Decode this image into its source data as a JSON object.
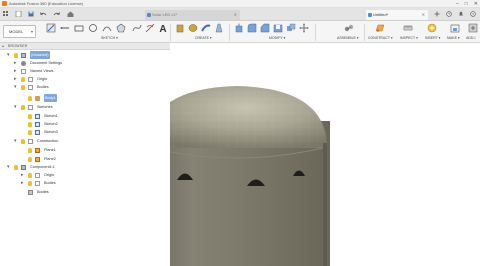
{
  "window": {
    "app_title": "Autodesk Fusion 360 (Education License)",
    "controls": [
      "–",
      "□",
      "✕"
    ]
  },
  "tabs": [
    {
      "label": "Solar LED v1*",
      "active": false
    },
    {
      "label": "Untitled*",
      "active": true
    }
  ],
  "workspace": {
    "label": "MODEL"
  },
  "ribbon_groups": [
    {
      "label": "SKETCH ▾"
    },
    {
      "label": "CREATE ▾"
    },
    {
      "label": "MODIFY ▾"
    },
    {
      "label": "ASSEMBLE ▾"
    },
    {
      "label": "CONSTRUCT ▾"
    },
    {
      "label": "INSPECT ▾"
    },
    {
      "label": "INSERT ▾"
    },
    {
      "label": "MAKE ▾"
    },
    {
      "label": "ADD-I"
    }
  ],
  "browser": {
    "header": "BROWSER",
    "items": [
      {
        "label": "(Unsaved)",
        "icon": "component-icon",
        "highlight": true
      },
      {
        "label": "Document Settings",
        "icon": "gear-icon"
      },
      {
        "label": "Named Views",
        "icon": "folder-icon"
      },
      {
        "label": "Origin",
        "icon": "folder-icon"
      },
      {
        "label": "Bodies",
        "icon": "folder-icon"
      },
      {
        "label": "Body1",
        "icon": "body-icon"
      },
      {
        "label": "Sketches",
        "icon": "folder-icon"
      },
      {
        "label": "Sketch1",
        "icon": "sketch-icon"
      },
      {
        "label": "Sketch2",
        "icon": "sketch-icon"
      },
      {
        "label": "Sketch3",
        "icon": "sketch-icon"
      },
      {
        "label": "Construction",
        "icon": "folder-icon"
      },
      {
        "label": "Plane1",
        "icon": "plane-icon"
      },
      {
        "label": "Plane2",
        "icon": "plane-icon"
      },
      {
        "label": "Component1:1",
        "icon": "component-icon"
      },
      {
        "label": "Origin",
        "icon": "folder-icon"
      },
      {
        "label": "Bodies",
        "icon": "folder-icon"
      },
      {
        "label": "Bodies",
        "icon": "body-icon"
      }
    ]
  },
  "colors": {
    "accent": "#f07c1a",
    "bulb": "#e8c22f",
    "folder": "#9a9a9a",
    "highlight": "#7fa7d8",
    "body": "#7f7d6f"
  }
}
